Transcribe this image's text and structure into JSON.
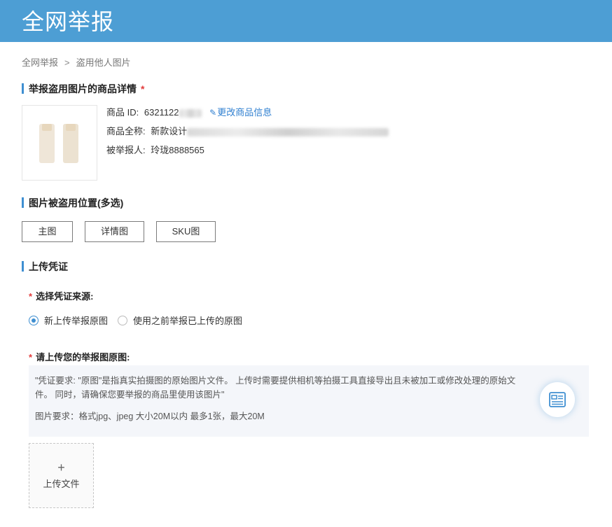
{
  "header": {
    "title": "全网举报"
  },
  "breadcrumb": {
    "items": [
      "全网举报",
      "盗用他人图片"
    ],
    "separator": ">"
  },
  "sections": {
    "product": {
      "title": "举报盗用图片的商品详情",
      "required_mark": "*"
    },
    "position": {
      "title": "图片被盗用位置(多选)"
    },
    "evidence": {
      "title": "上传凭证"
    }
  },
  "product": {
    "id_label": "商品 ID:",
    "id_value": "6321122",
    "edit_link": "更改商品信息",
    "name_label": "商品全称:",
    "name_value": "新款设计",
    "reported_label": "被举报人:",
    "reported_value": "玲珑8888565"
  },
  "position_buttons": [
    "主图",
    "详情图",
    "SKU图"
  ],
  "source": {
    "label": "选择凭证来源:",
    "required_mark": "*",
    "options": [
      "新上传举报原图",
      "使用之前举报已上传的原图"
    ],
    "selected": 0
  },
  "upload": {
    "label": "请上传您的举报图原图:",
    "required_mark": "*",
    "notice": "\"凭证要求:  \"原图\"是指真实拍摄图的原始图片文件。 上传时需要提供相机等拍摄工具直接导出且未被加工或修改处理的原始文件。 同时，请确保您要举报的商品里使用该图片\"",
    "requirement": "图片要求：格式jpg、jpeg 大小20M以内 最多1张，最大20M",
    "plus": "+",
    "button_label": "上传文件"
  },
  "icons": {
    "edit": "pencil-icon",
    "doc": "document-icon"
  },
  "colors": {
    "header": "#4d9ed4",
    "accent": "#3f8fd1",
    "required": "#e23b3b",
    "link": "#2f7fd0"
  }
}
